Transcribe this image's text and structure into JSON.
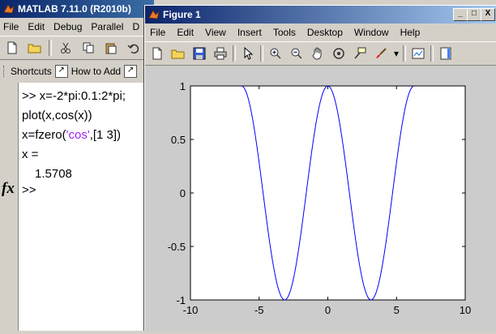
{
  "matlab": {
    "title": "MATLAB  7.11.0 (R2010b)",
    "menu": [
      "File",
      "Edit",
      "Debug",
      "Parallel",
      "D"
    ],
    "toolbar_icons": [
      "new-file-icon",
      "open-folder-icon",
      "cut-icon",
      "copy-icon",
      "paste-icon",
      "undo-icon"
    ],
    "shortcuts": [
      {
        "label": "Shortcuts",
        "icon": "shortcut-icon"
      },
      {
        "label": "How to Add",
        "icon": "shortcut-icon"
      }
    ]
  },
  "command_window": {
    "lines": [
      ">> x=-2*pi:0.1:2*pi;",
      "plot(x,cos(x))",
      "x=fzero(",
      "x =",
      "1.5708",
      ">>"
    ],
    "fzero_string": "'cos'",
    "fzero_tail": ",[1 3])",
    "fx_label": "fx"
  },
  "figure": {
    "title": "Figure 1",
    "menu": [
      "File",
      "Edit",
      "View",
      "Insert",
      "Tools",
      "Desktop",
      "Window",
      "Help"
    ],
    "window_buttons": {
      "minimize": "_",
      "maximize": "□",
      "close": "X"
    },
    "toolbar_icons": [
      "new-figure-icon",
      "open-file-icon",
      "save-icon",
      "print-icon",
      "edit-plot-arrow-icon",
      "zoom-in-icon",
      "zoom-out-icon",
      "pan-hand-icon",
      "rotate-3d-icon",
      "data-cursor-icon",
      "brush-icon",
      "link-plot-icon",
      "colorbar-icon"
    ]
  },
  "chart_data": {
    "type": "line",
    "title": "",
    "xlabel": "",
    "ylabel": "",
    "xlim": [
      -10,
      10
    ],
    "ylim": [
      -1,
      1
    ],
    "xticks": [
      -10,
      -5,
      0,
      5,
      10
    ],
    "yticks": [
      -1,
      -0.5,
      0,
      0.5,
      1
    ],
    "xtick_labels": [
      "-10",
      "-5",
      "0",
      "5",
      "10"
    ],
    "ytick_labels": [
      "-1",
      "-0.5",
      "0",
      "0.5",
      "1"
    ],
    "grid": false,
    "series_color": "#0000ff",
    "function": "cos(x)",
    "x_range": [
      -6.2832,
      6.2832
    ],
    "x_step": 0.1
  }
}
